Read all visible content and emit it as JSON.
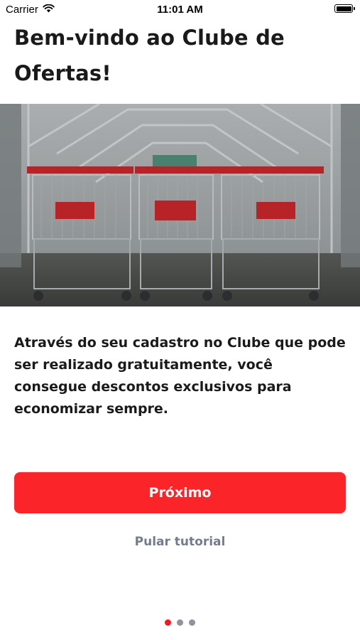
{
  "status_bar": {
    "carrier": "Carrier",
    "time": "11:01 AM",
    "wifi_icon": "wifi-icon",
    "battery_icon": "battery-icon"
  },
  "onboarding": {
    "title": "Bem-vindo ao Clube de Ofertas!",
    "image_icon": "shopping-carts-photo",
    "description": "Através do seu cadastro no Clube que pode ser realizado gratuitamente, você consegue descontos exclusivos para economizar sempre.",
    "next_label": "Próximo",
    "skip_label": "Pular tutorial",
    "page_count": 3,
    "current_page": 1
  },
  "colors": {
    "accent": "#fb2529",
    "skip_text": "#747b8c",
    "dot_active": "#ee1c22",
    "dot_inactive": "#8e949c"
  }
}
